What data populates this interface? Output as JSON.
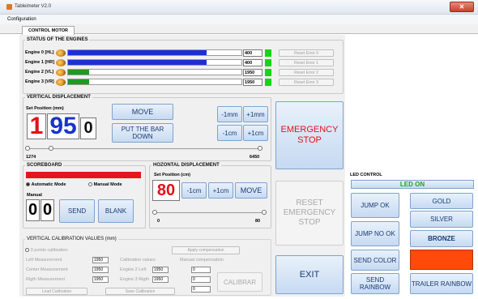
{
  "window": {
    "title": "Tableimeter V2.0",
    "close_glyph": "✕"
  },
  "menu": {
    "configuration": "Configuration"
  },
  "tabs": [
    {
      "label": "CONTROL MOTOR"
    }
  ],
  "engines": {
    "title": "STATUS OF THE ENGINES",
    "rows": [
      {
        "label": "Engine 0 [HL]",
        "bar_color": "#1b2fd6",
        "level": 0.8,
        "value": "400",
        "reset": "Reset Error 0"
      },
      {
        "label": "Engine 1 [HR]",
        "bar_color": "#1b2fd6",
        "level": 0.8,
        "value": "400",
        "reset": "Reset Error 1"
      },
      {
        "label": "Engine 2 [VL]",
        "bar_color": "#1d9a26",
        "level": 0.12,
        "value": "1950",
        "reset": "Reset Error 2"
      },
      {
        "label": "Engine 3 [VR]",
        "bar_color": "#1d9a26",
        "level": 0.12,
        "value": "1950",
        "reset": "Reset Error 3"
      }
    ]
  },
  "vertical": {
    "title": "VERTICAL DISPLACEMENT",
    "set_position_label": "Set Position (mm)",
    "digits": [
      "1",
      "95",
      "0"
    ],
    "move": "MOVE",
    "put_bar_down": "PUT THE BAR DOWN",
    "minus_1mm": "-1mm",
    "plus_1mm": "+1mm",
    "minus_1cm": "-1cm",
    "plus_1cm": "+1cm",
    "slider_min": "1274",
    "slider_max": "6450"
  },
  "emergency_stop": "EMERGENCY STOP",
  "reset_emergency_stop": "RESET EMERGENCY STOP",
  "exit": "EXIT",
  "scoreboard": {
    "title": "SCOREBOARD",
    "auto_mode": "Automatic Mode",
    "manual_mode": "Manual Mode",
    "manual_label": "Manual",
    "digits": [
      "0",
      "0"
    ],
    "send": "SEND",
    "blank": "BLANK"
  },
  "horizontal": {
    "title": "HOZONTAL DISPLACEMENT",
    "set_position_label": "Set Position (cm)",
    "value": "80",
    "minus_1cm": "-1cm",
    "plus_1cm": "+1cm",
    "move": "MOVE",
    "slider_min": "0",
    "slider_max": "80"
  },
  "calibration": {
    "title": "VERTICAL CALIBRATION VALUES (mm)",
    "three_point": "3 points calibration",
    "apply_compensation": "Apply compensation",
    "left_measurement": "Left Measurement",
    "center_measurement": "Center Measurement",
    "right_measurement": "Rigth Measurement",
    "left_val": "1950",
    "center_val": "1950",
    "right_val": "1950",
    "calibration_values": "Calibration values",
    "engine2_left": "Engine 2 Left",
    "engine3_right": "Engine 3 Rigth",
    "engine2_val": "1950",
    "engine3_val": "1950",
    "manual_compensation": "Manual compensation",
    "comp1": "0",
    "comp2": "0",
    "comp3": "0",
    "calibrar": "CALIBRAR",
    "load_calibration": "Load Calibration",
    "save_calibration": "Save Calibration"
  },
  "led": {
    "title": "LED CONTROL",
    "led_on": "LED ON",
    "jump_ok": "JUMP OK",
    "jump_no_ok": "JUMP NO OK",
    "send_color": "SEND COLOR",
    "send_rainbow": "SEND RAINBOW",
    "gold": "GOLD",
    "silver": "SILVER",
    "bronze": "BRONZE",
    "trailer_rainbow": "TRAILER RAINBOW",
    "color_swatch": "#ff4a0a"
  },
  "colors": {
    "digit_red": "#e0111a",
    "digit_blue": "#1a34c8",
    "scoreboard_red": "#e8141c",
    "emergency_red": "#e0111a"
  }
}
